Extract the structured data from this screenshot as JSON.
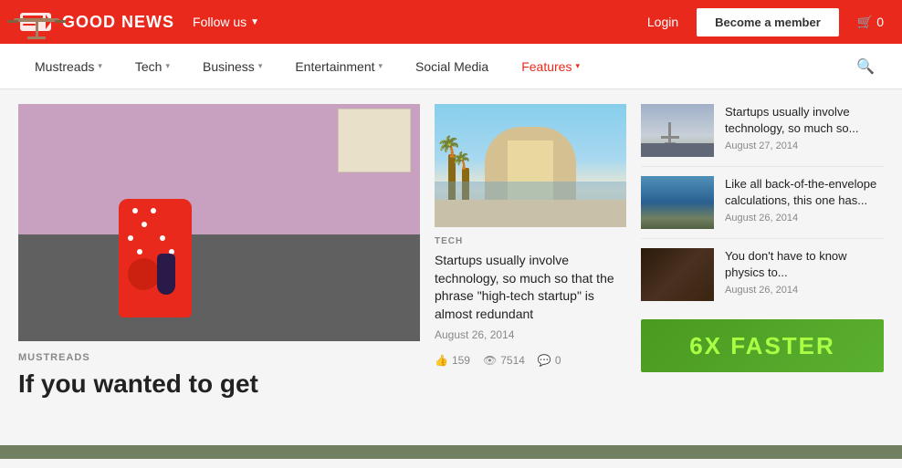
{
  "header": {
    "logo_text": "GOOD NEWS",
    "follow_us": "Follow us",
    "login": "Login",
    "become_member": "Become a member",
    "cart_count": "0"
  },
  "nav": {
    "items": [
      {
        "label": "Mustreads",
        "has_dropdown": true,
        "active": false
      },
      {
        "label": "Tech",
        "has_dropdown": true,
        "active": false
      },
      {
        "label": "Business",
        "has_dropdown": true,
        "active": false
      },
      {
        "label": "Entertainment",
        "has_dropdown": true,
        "active": false
      },
      {
        "label": "Social Media",
        "has_dropdown": false,
        "active": false
      },
      {
        "label": "Features",
        "has_dropdown": true,
        "active": true
      }
    ]
  },
  "left_article": {
    "tag": "MUSTREADS",
    "title": "If you wanted to get"
  },
  "middle_article": {
    "tag": "TECH",
    "title": "Startups usually involve technology, so much so that the phrase \"high-tech startup\" is almost redundant",
    "date": "August 26, 2014",
    "stats": {
      "likes": "159",
      "views": "7514",
      "comments": "0"
    }
  },
  "sidebar": {
    "articles": [
      {
        "title": "Startups usually involve technology, so much so...",
        "date": "August 27, 2014"
      },
      {
        "title": "Like all back-of-the-envelope calculations, this one has...",
        "date": "August 26, 2014"
      },
      {
        "title": "You don't have to know physics to...",
        "date": "August 26, 2014"
      }
    ]
  },
  "banner": {
    "prefix": "6X",
    "suffix": "FASTER"
  }
}
